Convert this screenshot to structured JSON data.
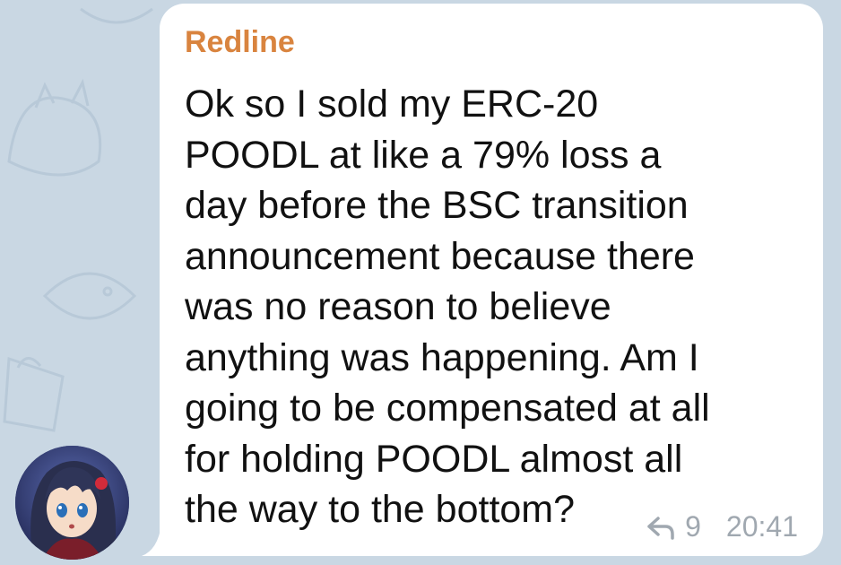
{
  "colors": {
    "background": "#c9d7e3",
    "bubble": "#ffffff",
    "sender_name": "#d9843f",
    "message_text": "#111111",
    "meta_text": "#a0a8b0"
  },
  "message": {
    "sender": "Redline",
    "text": "Ok so I sold my ERC-20\nPOODL at like a 79% loss a\nday before the BSC transition\nannouncement because there\nwas no reason to believe\nanything was happening. Am I\ngoing to be compensated at all\nfor holding POODL almost all\nthe way to the bottom?",
    "replies_count": "9",
    "time": "20:41",
    "reply_icon": "reply-arrow-icon",
    "avatar": "anime-avatar"
  }
}
